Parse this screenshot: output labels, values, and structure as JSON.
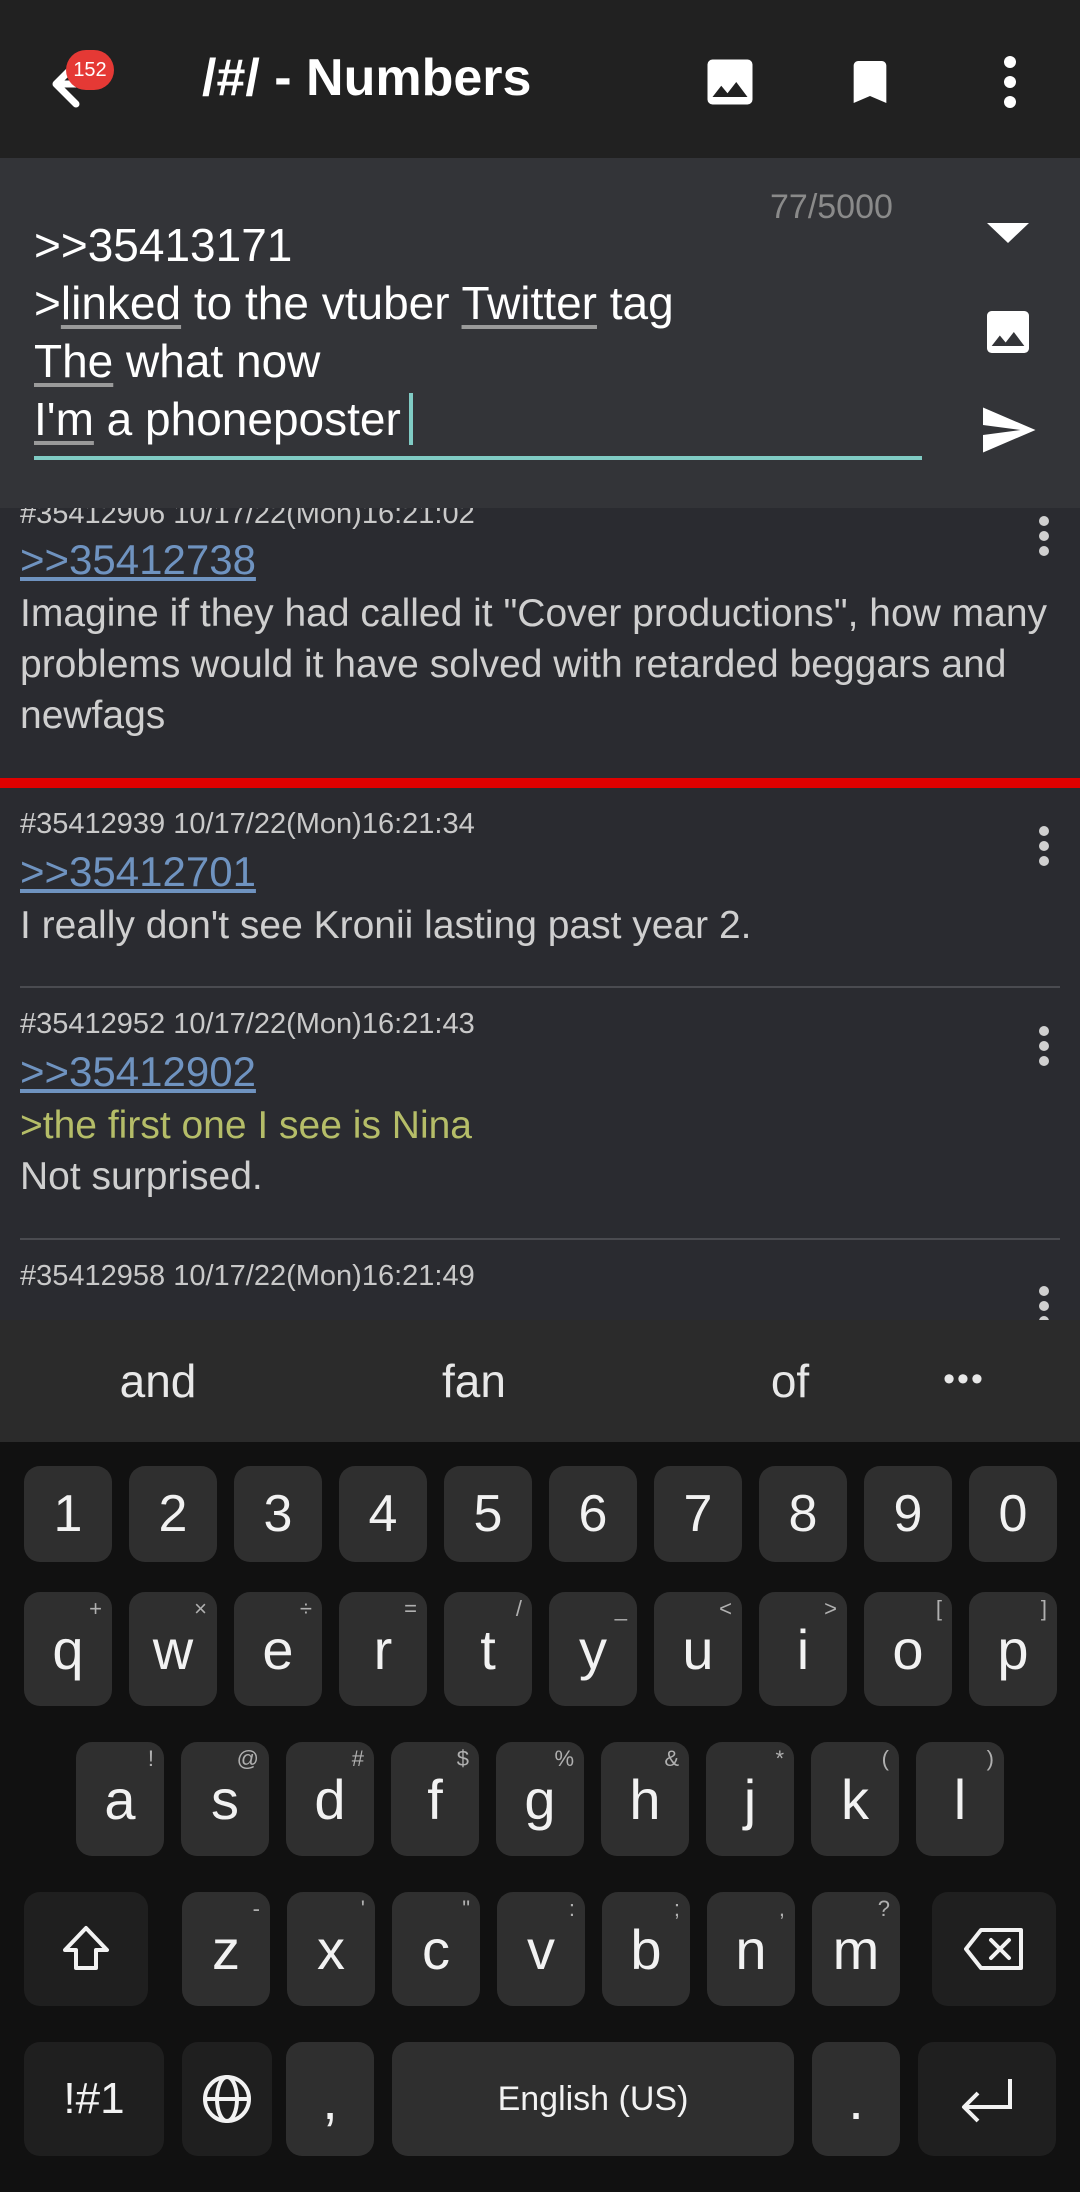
{
  "app_bar": {
    "unread_badge": "152",
    "title": "/#/ - Numbers",
    "icons": [
      "back-arrow-icon",
      "image-icon",
      "bookmark-icon",
      "more-vert-icon"
    ]
  },
  "composer": {
    "char_counter": "77/5000",
    "line1": ">>35413171",
    "line2_prefix": ">",
    "line2_word1": "linked",
    "line2_mid": " to the vtuber ",
    "line2_word2": "Twitter",
    "line2_suffix": " tag",
    "line3_word": "The",
    "line3_rest": " what now",
    "line4_word": "I'm",
    "line4_rest": " a phoneposter",
    "icons": [
      "collapse-icon",
      "attach-image-icon",
      "send-icon"
    ]
  },
  "posts": [
    {
      "meta": "#35412906 10/17/22(Mon)16:21:02",
      "quote_link": ">>35412738",
      "body": "Imagine if they had called it \"Cover productions\", how many problems would it have solved with retarded beggars and newfags"
    },
    {
      "meta": "#35412939 10/17/22(Mon)16:21:34",
      "quote_link": ">>35412701",
      "body": "I really don't see Kronii lasting past year 2."
    },
    {
      "meta": "#35412952 10/17/22(Mon)16:21:43",
      "quote_link": ">>35412902",
      "greentext": ">the first one I see is Nina",
      "body": "Not surprised."
    },
    {
      "meta": "#35412958 10/17/22(Mon)16:21:49"
    }
  ],
  "suggestions": [
    "and",
    "fan",
    "of",
    "•••"
  ],
  "keyboard": {
    "number_row": [
      "1",
      "2",
      "3",
      "4",
      "5",
      "6",
      "7",
      "8",
      "9",
      "0"
    ],
    "row1": [
      {
        "k": "q",
        "h": "+"
      },
      {
        "k": "w",
        "h": "×"
      },
      {
        "k": "e",
        "h": "÷"
      },
      {
        "k": "r",
        "h": "="
      },
      {
        "k": "t",
        "h": "/"
      },
      {
        "k": "y",
        "h": "_"
      },
      {
        "k": "u",
        "h": "<"
      },
      {
        "k": "i",
        "h": ">"
      },
      {
        "k": "o",
        "h": "["
      },
      {
        "k": "p",
        "h": "]"
      }
    ],
    "row2": [
      {
        "k": "a",
        "h": "!"
      },
      {
        "k": "s",
        "h": "@"
      },
      {
        "k": "d",
        "h": "#"
      },
      {
        "k": "f",
        "h": "$"
      },
      {
        "k": "g",
        "h": "%"
      },
      {
        "k": "h",
        "h": "&"
      },
      {
        "k": "j",
        "h": "*"
      },
      {
        "k": "k",
        "h": "("
      },
      {
        "k": "l",
        "h": ")"
      }
    ],
    "row3": [
      {
        "k": "z",
        "h": "-"
      },
      {
        "k": "x",
        "h": "'"
      },
      {
        "k": "c",
        "h": "\""
      },
      {
        "k": "v",
        "h": ":"
      },
      {
        "k": "b",
        "h": ";"
      },
      {
        "k": "n",
        "h": ","
      },
      {
        "k": "m",
        "h": "?"
      }
    ],
    "symbols_key": "!#1",
    "comma_key": ",",
    "space_label": "English (US)",
    "period_key": ".",
    "icons": [
      "shift-icon",
      "backspace-icon",
      "globe-icon",
      "enter-icon"
    ]
  }
}
